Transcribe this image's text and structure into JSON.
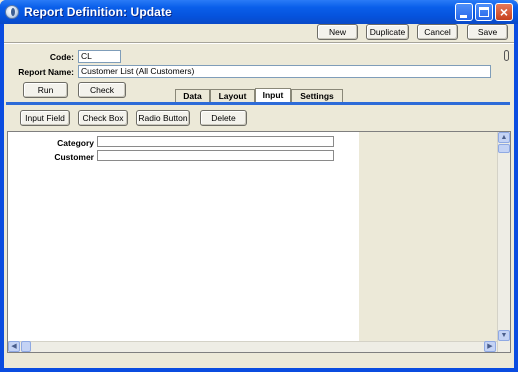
{
  "window": {
    "title": "Report Definition: Update",
    "controls": {
      "minimize": "minimize",
      "maximize": "maximize",
      "close": "×"
    }
  },
  "toolbar": {
    "new_label": "New",
    "duplicate_label": "Duplicate",
    "cancel_label": "Cancel",
    "save_label": "Save"
  },
  "header": {
    "code_label": "Code:",
    "code_value": "CL",
    "report_name_label": "Report Name:",
    "report_name_value": "Customer List (All Customers)",
    "run_label": "Run",
    "check_label": "Check"
  },
  "tabs": [
    {
      "label": "Data",
      "active": false
    },
    {
      "label": "Layout",
      "active": false
    },
    {
      "label": "Input",
      "active": true
    },
    {
      "label": "Settings",
      "active": false
    }
  ],
  "input_toolbar": {
    "input_field_label": "Input Field",
    "check_box_label": "Check Box",
    "radio_button_label": "Radio Button",
    "delete_label": "Delete"
  },
  "canvas": {
    "fields": [
      {
        "label": "Category",
        "value": ""
      },
      {
        "label": "Customer",
        "value": ""
      }
    ]
  },
  "icons": {
    "app": "app-icon",
    "attachment": "paperclip-icon",
    "scroll_up": "arrow-up-icon",
    "scroll_down": "arrow-down-icon",
    "scroll_left": "arrow-left-icon",
    "scroll_right": "arrow-right-icon"
  },
  "colors": {
    "titlebar": "#0a5fea",
    "active_tab_underline": "#2d6bd8",
    "window_bg": "#ece9d8"
  }
}
